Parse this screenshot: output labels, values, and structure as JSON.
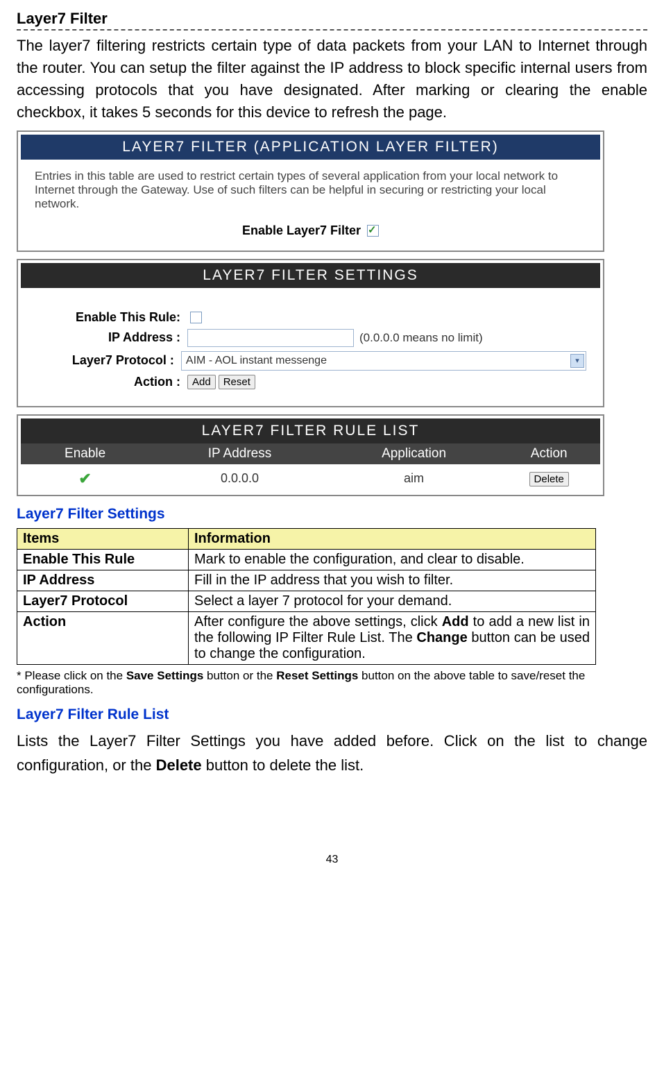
{
  "title": "Layer7 Filter",
  "intro": "The layer7 filtering restricts certain type of data packets from your LAN to Internet through the router. You can setup the filter against the IP address to block specific internal users from accessing protocols that you have designated. After marking or clearing the enable checkbox, it takes 5 seconds for this device to refresh the page.",
  "panel1": {
    "header": "LAYER7 FILTER (APPLICATION LAYER FILTER)",
    "desc": "Entries in this table are used to restrict certain types of several application from your local network to Internet through the Gateway. Use of such filters can be helpful in securing or restricting your local network.",
    "enable_label": "Enable Layer7 Filter"
  },
  "panel2": {
    "header": "LAYER7 FILTER SETTINGS",
    "rule_label": "Enable This Rule:",
    "ip_label": "IP Address :",
    "ip_hint": "(0.0.0.0 means no limit)",
    "proto_label": "Layer7 Protocol :",
    "proto_value": "AIM - AOL instant messenge",
    "action_label": "Action :",
    "add_btn": "Add",
    "reset_btn": "Reset"
  },
  "panel3": {
    "header": "LAYER7 FILTER RULE LIST",
    "cols": {
      "enable": "Enable",
      "ip": "IP Address",
      "app": "Application",
      "action": "Action"
    },
    "row": {
      "ip": "0.0.0.0",
      "app": "aim",
      "delete": "Delete"
    }
  },
  "subhead_settings": "Layer7 Filter Settings",
  "doc_table": {
    "h_items": "Items",
    "h_info": "Information",
    "rows": [
      {
        "item": "Enable This Rule",
        "info_plain": "Mark to enable the configuration, and clear to disable."
      },
      {
        "item": "IP Address",
        "info_plain": "Fill in the IP address that you wish to filter."
      },
      {
        "item": "Layer7 Protocol",
        "info_plain": "Select a layer 7 protocol for your demand."
      },
      {
        "item": "Action",
        "info_pre": "After configure the above settings, click ",
        "b1": "Add",
        "info_mid": " to add a new list in the following IP Filter Rule List. The ",
        "b2": "Change",
        "info_post": " button can be used to change the configuration."
      }
    ]
  },
  "footnote_pre": "* Please click on the ",
  "footnote_b1": "Save Settings",
  "footnote_mid": " button or the ",
  "footnote_b2": "Reset Settings",
  "footnote_post": " button on the above table to save/reset the configurations.",
  "subhead_rulelist": "Layer7 Filter Rule List",
  "rulelist_para_pre": "Lists the Layer7 Filter Settings you have added before. Click on the list to change configuration, or the ",
  "rulelist_para_b": "Delete",
  "rulelist_para_post": " button to delete the list.",
  "page_number": "43"
}
